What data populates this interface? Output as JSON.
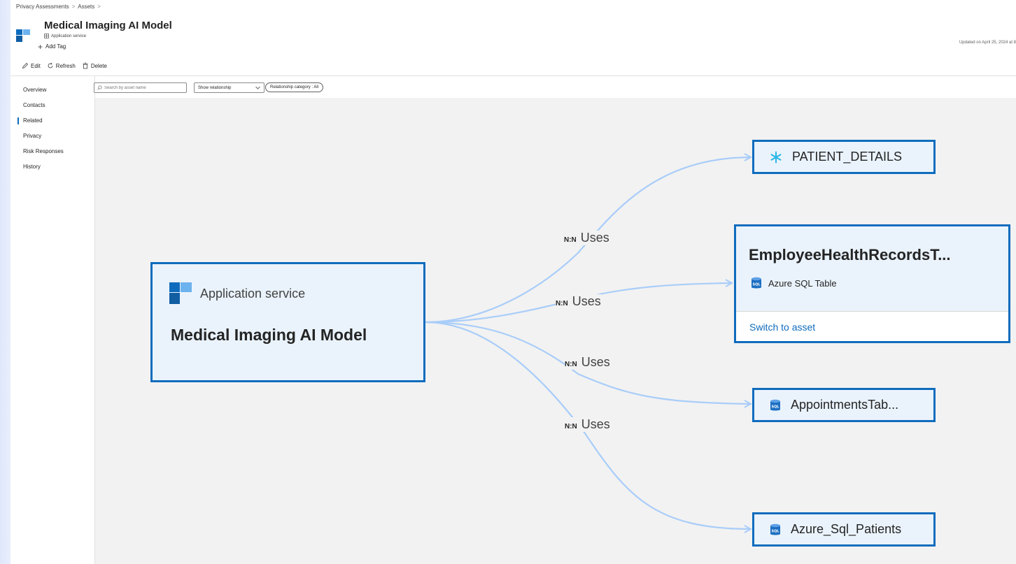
{
  "breadcrumb": {
    "items": [
      "Privacy Assessments",
      "Assets"
    ],
    "separator": ">"
  },
  "asset": {
    "title": "Medical Imaging AI Model",
    "type": "Application service",
    "add_tag_label": "Add Tag",
    "updated_text": "Updated on April 25, 2024 at 8"
  },
  "toolbar": {
    "edit_label": "Edit",
    "refresh_label": "Refresh",
    "delete_label": "Delete"
  },
  "nav": {
    "items": [
      {
        "label": "Overview",
        "active": false
      },
      {
        "label": "Contacts",
        "active": false
      },
      {
        "label": "Related",
        "active": true
      },
      {
        "label": "Privacy",
        "active": false
      },
      {
        "label": "Risk Responses",
        "active": false
      },
      {
        "label": "History",
        "active": false
      }
    ]
  },
  "filters": {
    "search_placeholder": "Search by asset name",
    "relationship_dropdown": "Show relationship",
    "category_pill": "Relationship category : All"
  },
  "graph": {
    "source": {
      "type": "Application service",
      "name": "Medical Imaging AI Model"
    },
    "edges": [
      {
        "cardinality": "N:N",
        "label": "Uses"
      },
      {
        "cardinality": "N:N",
        "label": "Uses"
      },
      {
        "cardinality": "N:N",
        "label": "Uses"
      },
      {
        "cardinality": "N:N",
        "label": "Uses"
      }
    ],
    "targets": [
      {
        "name": "PATIENT_DETAILS",
        "icon": "snowflake-icon"
      },
      {
        "name": "EmployeeHealthRecordsT...",
        "type": "Azure SQL Table",
        "icon": "sql-database-icon",
        "action": "Switch to asset"
      },
      {
        "name": "AppointmentsTab...",
        "icon": "sql-database-icon"
      },
      {
        "name": "Azure_Sql_Patients",
        "icon": "sql-database-icon"
      }
    ]
  },
  "colors": {
    "accent": "#0f6cbd",
    "node_fill": "#eaf3fc",
    "edge": "#a9cdf9",
    "canvas": "#f2f2f2"
  }
}
